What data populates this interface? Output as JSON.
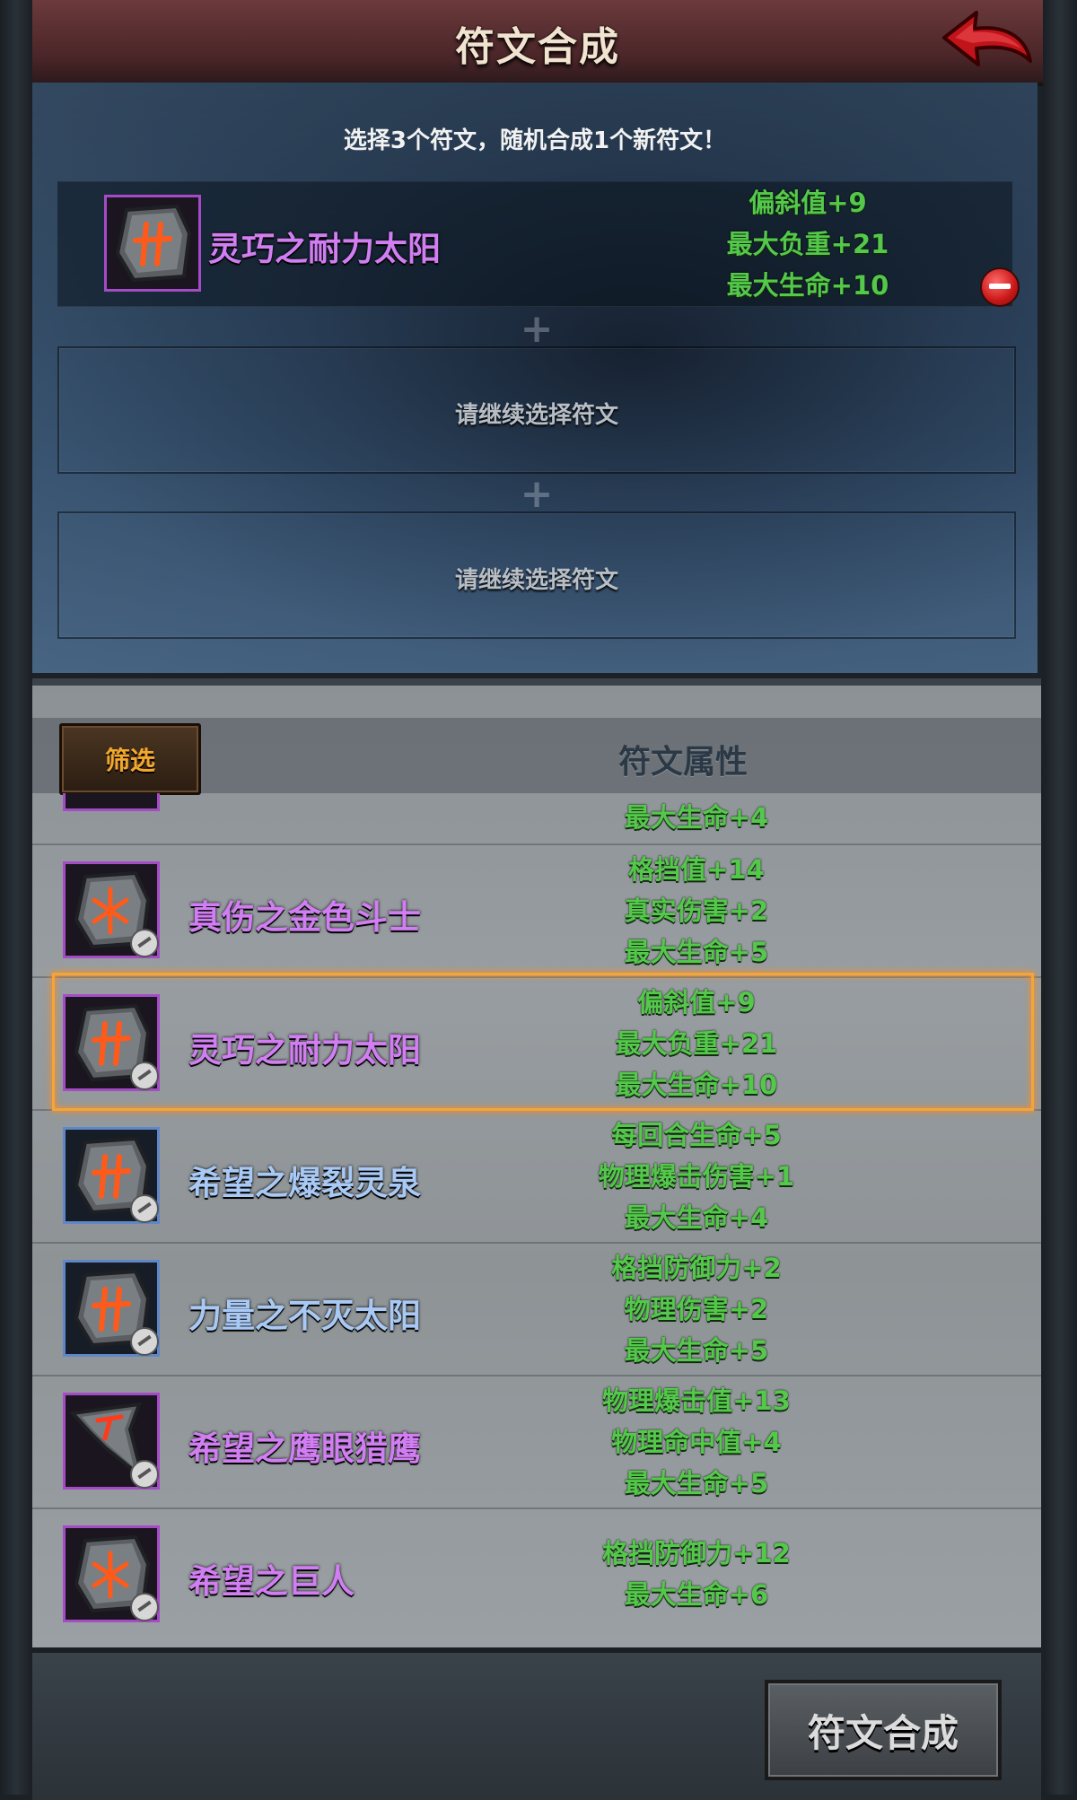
{
  "header": {
    "title": "符文合成",
    "back_icon": "red-curved-arrow-icon"
  },
  "selection": {
    "hint": "选择3个符文，随机合成1个新符文！",
    "selected": {
      "name": "灵巧之耐力太阳",
      "rarity": "purple",
      "stats": [
        "偏斜值+9",
        "最大负重+21",
        "最大生命+10"
      ]
    },
    "empty_slot_text_1": "请继续选择符文",
    "empty_slot_text_2": "请继续选择符文"
  },
  "list": {
    "filter_label": "筛选",
    "column_header": "符文属性",
    "partial_row_stat": "最大生命+4",
    "rows": [
      {
        "name": "真伤之金色斗士",
        "rarity": "purple",
        "stats": [
          "格挡值+14",
          "真实伤害+2",
          "最大生命+5"
        ]
      },
      {
        "name": "灵巧之耐力太阳",
        "rarity": "purple",
        "selected": true,
        "stats": [
          "偏斜值+9",
          "最大负重+21",
          "最大生命+10"
        ]
      },
      {
        "name": "希望之爆裂灵泉",
        "rarity": "blue",
        "stats": [
          "每回合生命+5",
          "物理爆击伤害+1",
          "最大生命+4"
        ]
      },
      {
        "name": "力量之不灭太阳",
        "rarity": "blue",
        "stats": [
          "格挡防御力+2",
          "物理伤害+2",
          "最大生命+5"
        ]
      },
      {
        "name": "希望之鹰眼猎鹰",
        "rarity": "purple",
        "stats": [
          "物理爆击值+13",
          "物理命中值+4",
          "最大生命+5"
        ]
      },
      {
        "name": "希望之巨人",
        "rarity": "purple",
        "stats": [
          "格挡防御力+12",
          "最大生命+6"
        ]
      }
    ]
  },
  "footer": {
    "compose_label": "符文合成"
  },
  "colors": {
    "stat_green": "#54c84a",
    "purple": "#d07ef1",
    "blue": "#a9c9f5",
    "highlight": "#f3a53a"
  }
}
